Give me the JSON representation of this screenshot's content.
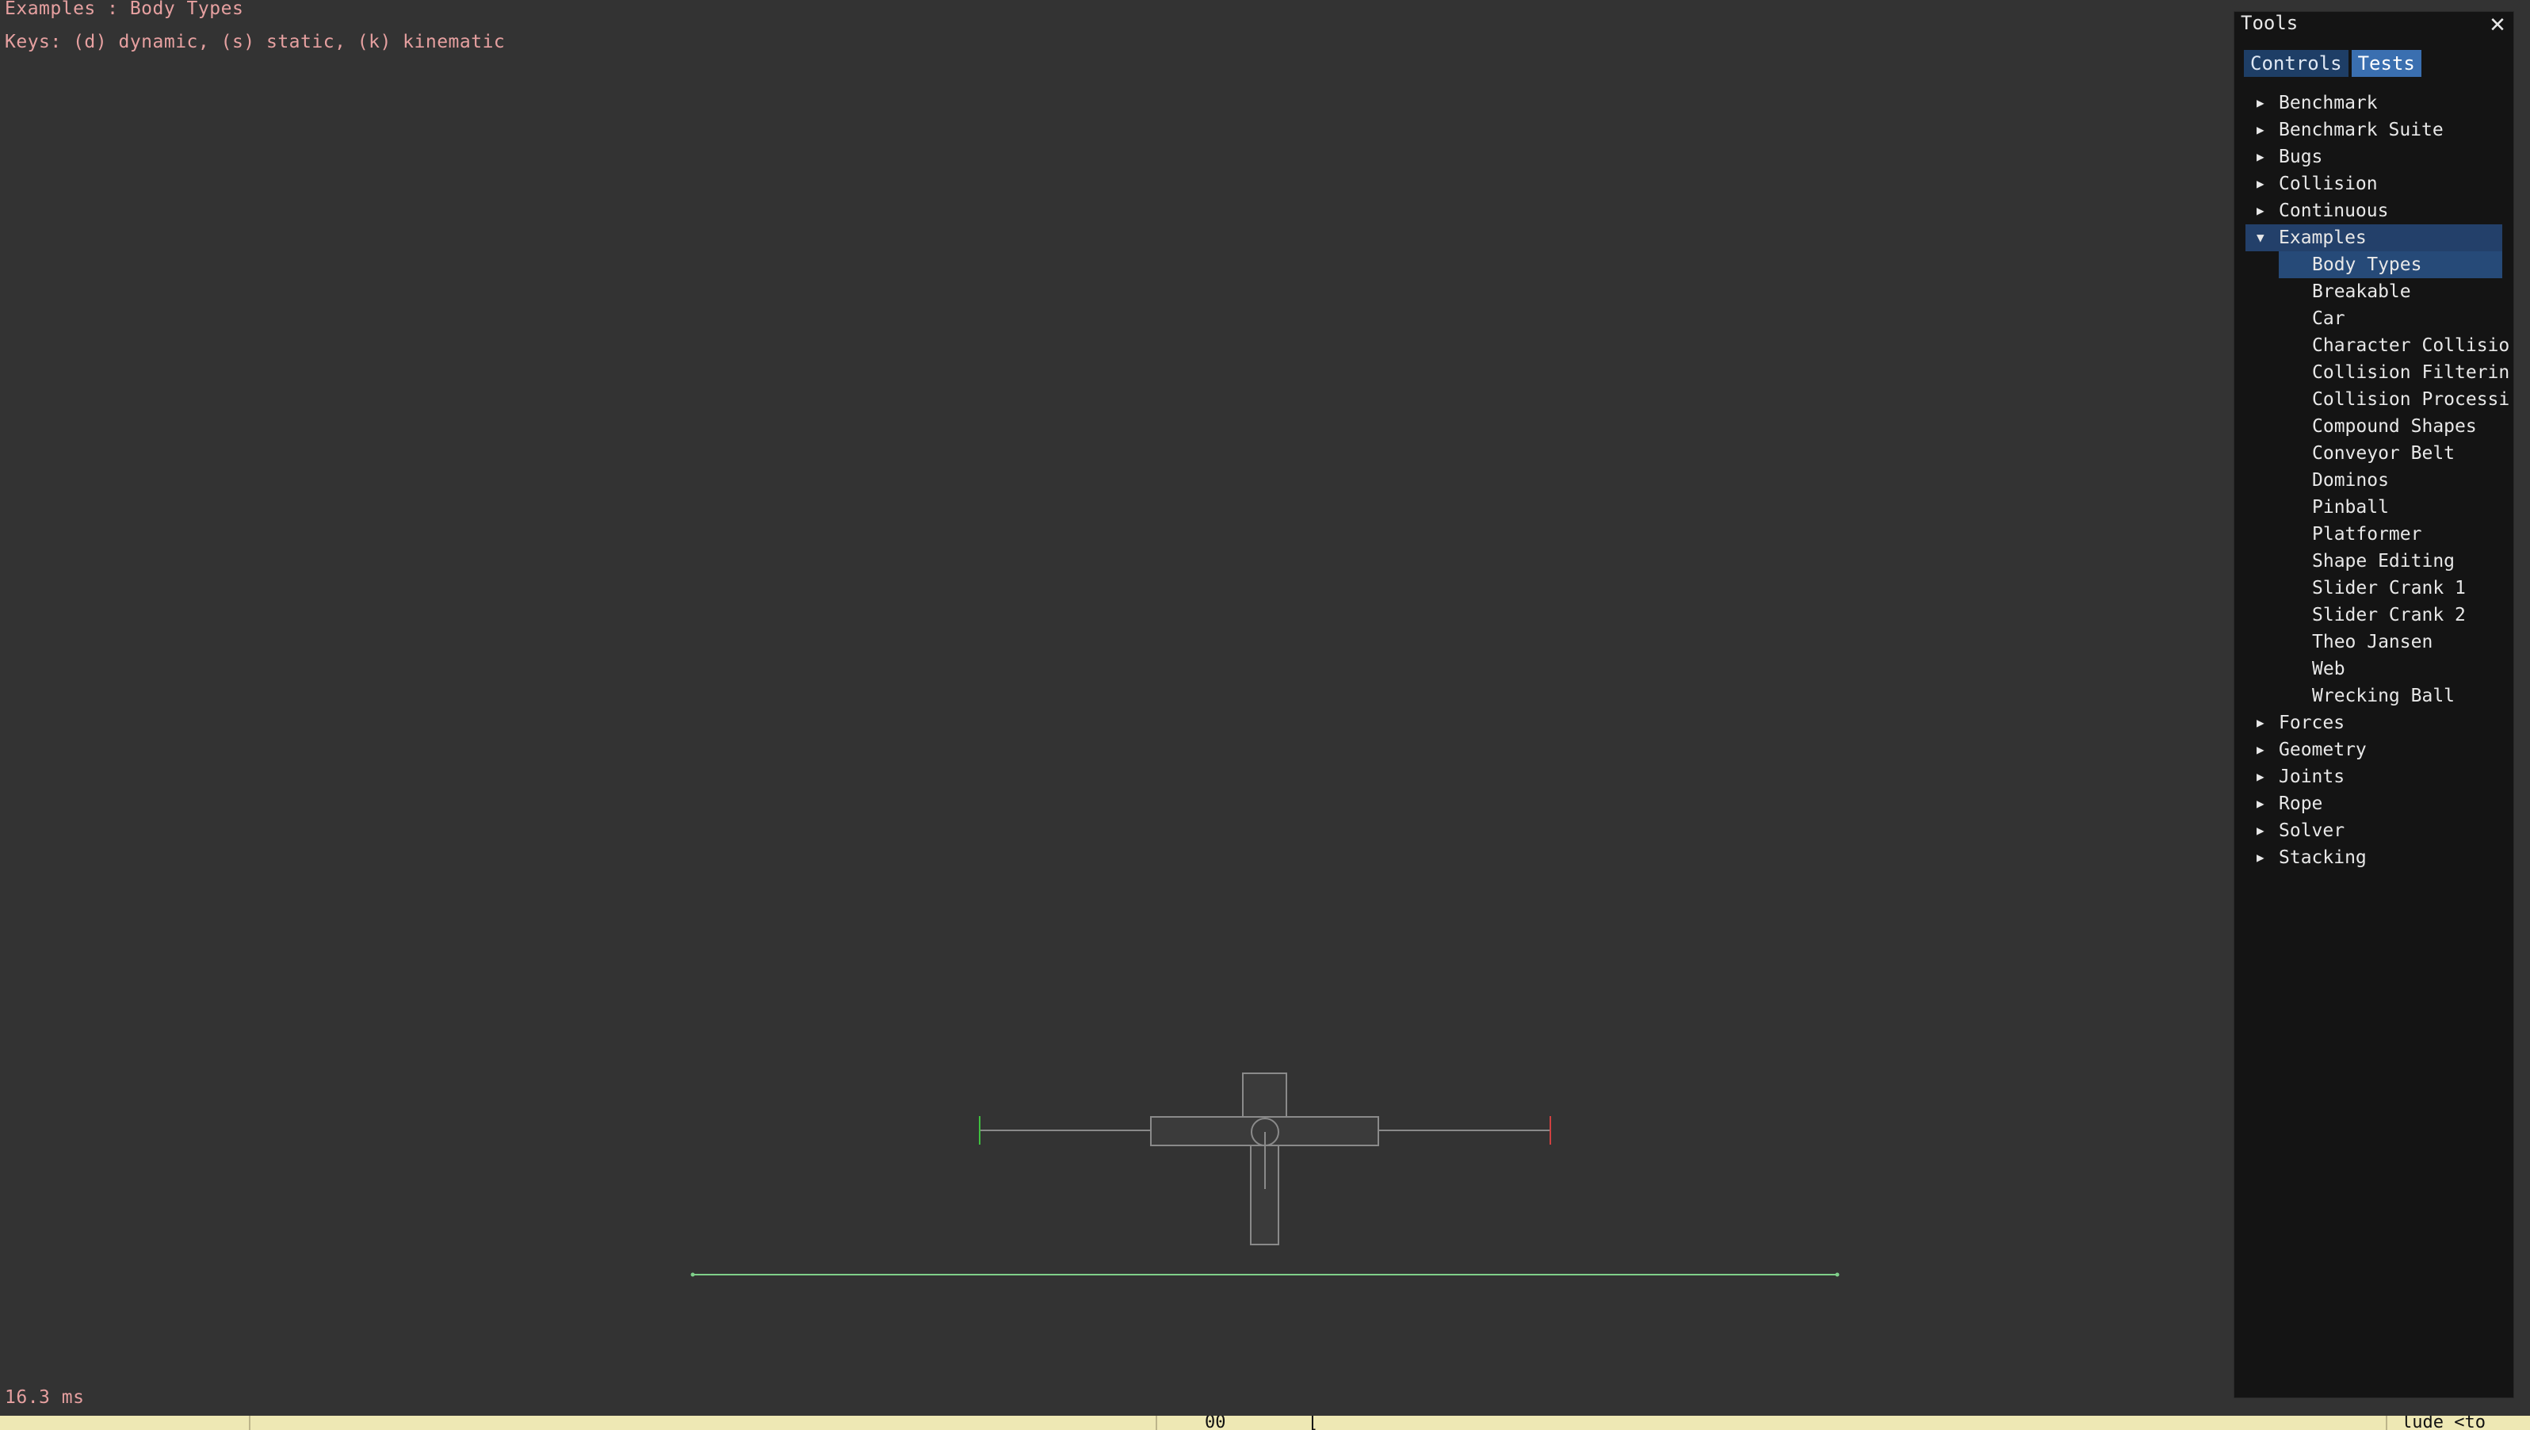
{
  "overlay": {
    "title": "Examples : Body Types",
    "keys": "Keys: (d) dynamic, (s) static, (k) kinematic",
    "timing": "16.3 ms"
  },
  "tools": {
    "title": "Tools",
    "close_icon": "close-icon",
    "tabs": [
      {
        "label": "Controls",
        "active": false
      },
      {
        "label": "Tests",
        "active": true
      }
    ],
    "categories_before": [
      "Benchmark",
      "Benchmark Suite",
      "Bugs",
      "Collision",
      "Continuous"
    ],
    "open_category": "Examples",
    "examples": [
      "Body Types",
      "Breakable",
      "Car",
      "Character Collisio",
      "Collision Filterin",
      "Collision Processi",
      "Compound Shapes",
      "Conveyor Belt",
      "Dominos",
      "Pinball",
      "Platformer",
      "Shape Editing",
      "Slider Crank 1",
      "Slider Crank 2",
      "Theo Jansen",
      "Web",
      "Wrecking Ball"
    ],
    "selected_example": "Body Types",
    "categories_after": [
      "Forces",
      "Geometry",
      "Joints",
      "Rope",
      "Solver",
      "Stacking"
    ]
  },
  "taskbar": {
    "fragments": [
      "00",
      "[",
      "lude <to"
    ]
  },
  "colors": {
    "background": "#333333",
    "overlay_text": "#e6a0a0",
    "panel_bg": "#141414",
    "tab_active": "#3a6fb0",
    "tab_inactive": "#1e3e66",
    "selection": "#264a78",
    "ground_line": "#7fd08a",
    "limit_left": "#3fbf3f",
    "limit_right": "#d04040",
    "body_outline": "#8a8a8a",
    "body_fill": "#3b3b3b"
  }
}
